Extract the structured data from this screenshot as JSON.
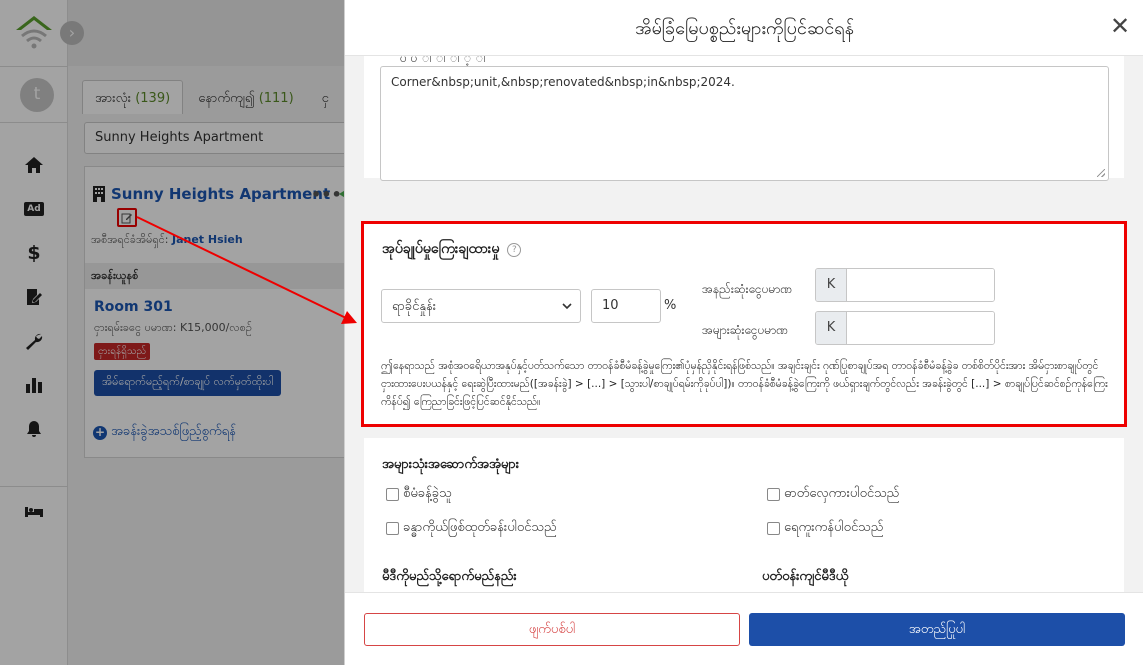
{
  "colors": {
    "accent_blue": "#1d4fa8",
    "link_blue": "#1b56b3",
    "highlight_red": "#e00000",
    "count_green": "#5c8a2a",
    "badge_red": "#c62828"
  },
  "background_app": {
    "avatar_letter": "t",
    "rail_icons": [
      "home-icon",
      "ad-icon",
      "dollar-icon",
      "document-edit-icon",
      "wrench-icon",
      "bar-chart-icon",
      "bell-icon",
      "bed-icon"
    ],
    "rail_ad_label": "Ad",
    "rail_dollar_label": "$",
    "tabs": [
      {
        "label": "အားလုံး",
        "count": "(139)"
      },
      {
        "label": "နောက်ကျ၍",
        "count": "(111)"
      },
      {
        "label": "ငှ",
        "count": ""
      }
    ],
    "search_value": "Sunny Heights Apartment",
    "property": {
      "title": "Sunny Heights Apartment",
      "more": "•••",
      "owner_label": "အစီအရင်ခံအိမ်ရှင်:",
      "owner_name": "Janet Hsieh",
      "rooms_header": "အခန်းယူနစ်",
      "room_name": "Room 301",
      "room_price": "ငှားရမ်းခငွေ ပမာဏ: K15,000/လစဉ်",
      "room_badge": "ငှားရန်ရှိသည်",
      "room_action": "အိမ်ရောက်မည့်ရက်/စာချုပ် လက်မှတ်ထိုးပါ",
      "add_room": "အခန်းခွဲအသစ်ဖြည့်စွက်ရန်"
    }
  },
  "modal": {
    "title": "အိမ်ခြံမြေပစ္စည်းများကိုပြင်ဆင်ရန်",
    "close_symbol": "✕",
    "partial_label": "ပ  ပ  ါ  ါ  ါ      ့  ါ",
    "description_value": "Corner&nbsp;unit,&nbsp;renovated&nbsp;in&nbsp;2024.",
    "commission": {
      "title": "အုပ်ချုပ်မှုကြေးချထားမှု",
      "help": "?",
      "select_value": "ရာခိုင်နှုန်း",
      "percent_value": "10",
      "percent_sign": "%",
      "min_label": "အနည်းဆုံးငွေပမာဏ",
      "max_label": "အများဆုံးငွေပမာဏ",
      "currency_prefix": "K",
      "min_value": "",
      "max_value": "",
      "note": "ဤနေရာသည် အစုံအဝရေိယာအနုပ်နှင့်ပတ်သက်သော တာဝန်ခံစီမံခန့်ခွဲမှုကြေး၏ပုံမှန်ညှိနိုင်းရန်ဖြစ်သည်။ အချင်းချင်း ဂုဏ်ပြုစာချုပ်အရ တာဝန်ခံစီမံခန့်ခွဲခ တစ်စိတ်ပိုင်းအား အိမ်ငှားစာချုပ်တွင် ငှားထားပေးပ​ယန်နှင့် ရေးဆွဲပြီးထားမည်([အခန်းခွဲ] > [...] > [သွားပါ/စာချုပ်ရမ်းကိုခုပ်ပါ])။ တာဝန်ခံစီမံခန့်ခွဲကြေးကို ဖယ်ရှားချက်တွင်လည်း အခန်းခွဲတွင် [...] > စာချုပ်ပြင်ဆင်စဉ်ကုန်ကြေးကိန်ပ်၍ ကြေညာခြင်းဖြင့်ပြင်ဆင်နိုင်သည်။"
    },
    "preferences": {
      "heading": "အများသုံးအဆောက်အအုံများ",
      "items": [
        "စီမံခန့်ခွဲသူ",
        "ဓာတ်လှေကားပါဝင်သည်",
        "ခန္ဓာကိုယ်ဖြစ်ထုတ်ခန်းပါဝင်သည်",
        "ရေကူးကန်ပါဝင်သည်"
      ],
      "left_subheading": "မီဒီကိုမည်သို့ရောက်မည်နည်း",
      "right_subheading": "ပတ်ဝန်းကျင်မီဒီယို"
    },
    "footer": {
      "cancel_label": "ဖျက်ပစ်ပါ",
      "confirm_label": "အတည်ပြုပါ"
    }
  }
}
